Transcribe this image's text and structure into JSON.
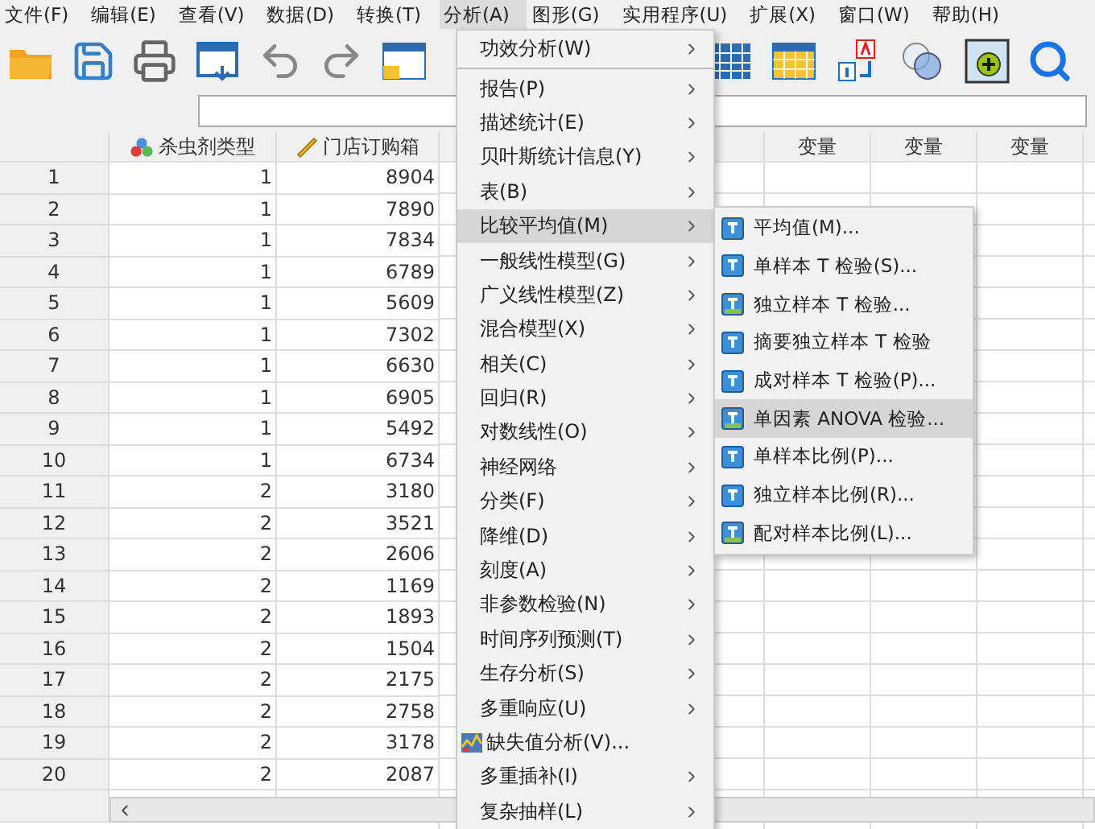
{
  "menubar": [
    {
      "label": "文件(F)",
      "selected": false
    },
    {
      "label": "编辑(E)",
      "selected": false
    },
    {
      "label": "查看(V)",
      "selected": false
    },
    {
      "label": "数据(D)",
      "selected": false
    },
    {
      "label": "转换(T)",
      "selected": false
    },
    {
      "label": "分析(A)",
      "selected": true
    },
    {
      "label": "图形(G)",
      "selected": false
    },
    {
      "label": "实用程序(U)",
      "selected": false
    },
    {
      "label": "扩展(X)",
      "selected": false
    },
    {
      "label": "窗口(W)",
      "selected": false
    },
    {
      "label": "帮助(H)",
      "selected": false
    }
  ],
  "table": {
    "columns": [
      {
        "label": "杀虫剂类型",
        "kind": "nominal"
      },
      {
        "label": "门店订购箱",
        "kind": "scale"
      }
    ],
    "empty_columns": [
      "变量",
      "变量",
      "变量"
    ],
    "rows": [
      {
        "row_header": "1",
        "cells": [
          "1",
          "8904"
        ]
      },
      {
        "row_header": "2",
        "cells": [
          "1",
          "7890"
        ]
      },
      {
        "row_header": "3",
        "cells": [
          "1",
          "7834"
        ]
      },
      {
        "row_header": "4",
        "cells": [
          "1",
          "6789"
        ]
      },
      {
        "row_header": "5",
        "cells": [
          "1",
          "5609"
        ]
      },
      {
        "row_header": "6",
        "cells": [
          "1",
          "7302"
        ]
      },
      {
        "row_header": "7",
        "cells": [
          "1",
          "6630"
        ]
      },
      {
        "row_header": "8",
        "cells": [
          "1",
          "6905"
        ]
      },
      {
        "row_header": "9",
        "cells": [
          "1",
          "5492"
        ]
      },
      {
        "row_header": "10",
        "cells": [
          "1",
          "6734"
        ]
      },
      {
        "row_header": "11",
        "cells": [
          "2",
          "3180"
        ]
      },
      {
        "row_header": "12",
        "cells": [
          "2",
          "3521"
        ]
      },
      {
        "row_header": "13",
        "cells": [
          "2",
          "2606"
        ]
      },
      {
        "row_header": "14",
        "cells": [
          "2",
          "1169"
        ]
      },
      {
        "row_header": "15",
        "cells": [
          "2",
          "1893"
        ]
      },
      {
        "row_header": "16",
        "cells": [
          "2",
          "1504"
        ]
      },
      {
        "row_header": "17",
        "cells": [
          "2",
          "2175"
        ]
      },
      {
        "row_header": "18",
        "cells": [
          "2",
          "2758"
        ]
      },
      {
        "row_header": "19",
        "cells": [
          "2",
          "3178"
        ]
      },
      {
        "row_header": "20",
        "cells": [
          "2",
          "2087"
        ]
      }
    ]
  },
  "analyze_menu": [
    {
      "label": "功效分析(W)",
      "kind": "submenu",
      "selected": false
    },
    {
      "kind": "separator"
    },
    {
      "label": "报告(P)",
      "kind": "submenu",
      "selected": false
    },
    {
      "label": "描述统计(E)",
      "kind": "submenu",
      "selected": false
    },
    {
      "label": "贝叶斯统计信息(Y)",
      "kind": "submenu",
      "selected": false
    },
    {
      "label": "表(B)",
      "kind": "submenu",
      "selected": false
    },
    {
      "label": "比较平均值(M)",
      "kind": "submenu",
      "selected": true
    },
    {
      "label": "一般线性模型(G)",
      "kind": "submenu",
      "selected": false
    },
    {
      "label": "广义线性模型(Z)",
      "kind": "submenu",
      "selected": false
    },
    {
      "label": "混合模型(X)",
      "kind": "submenu",
      "selected": false
    },
    {
      "label": "相关(C)",
      "kind": "submenu",
      "selected": false
    },
    {
      "label": "回归(R)",
      "kind": "submenu",
      "selected": false
    },
    {
      "label": "对数线性(O)",
      "kind": "submenu",
      "selected": false
    },
    {
      "label": "神经网络",
      "kind": "submenu",
      "selected": false
    },
    {
      "label": "分类(F)",
      "kind": "submenu",
      "selected": false
    },
    {
      "label": "降维(D)",
      "kind": "submenu",
      "selected": false
    },
    {
      "label": "刻度(A)",
      "kind": "submenu",
      "selected": false
    },
    {
      "label": "非参数检验(N)",
      "kind": "submenu",
      "selected": false
    },
    {
      "label": "时间序列预测(T)",
      "kind": "submenu",
      "selected": false
    },
    {
      "label": "生存分析(S)",
      "kind": "submenu",
      "selected": false
    },
    {
      "label": "多重响应(U)",
      "kind": "submenu",
      "selected": false
    },
    {
      "label": "缺失值分析(V)...",
      "kind": "command",
      "selected": false
    },
    {
      "label": "多重插补(I)",
      "kind": "submenu",
      "selected": false
    },
    {
      "label": "复杂抽样(L)",
      "kind": "submenu",
      "selected": false
    }
  ],
  "compare_means_submenu": [
    {
      "label": "平均值(M)...",
      "selected": false
    },
    {
      "label": "单样本 T 检验(S)...",
      "selected": false
    },
    {
      "label": "独立样本 T 检验...",
      "selected": false
    },
    {
      "label": "摘要独立样本 T 检验",
      "selected": false
    },
    {
      "label": "成对样本 T 检验(P)...",
      "selected": false
    },
    {
      "label": "单因素 ANOVA 检验...",
      "selected": true
    },
    {
      "label": "单样本比例(P)...",
      "selected": false
    },
    {
      "label": "独立样本比例(R)...",
      "selected": false
    },
    {
      "label": "配对样本比例(L)...",
      "selected": false
    }
  ]
}
